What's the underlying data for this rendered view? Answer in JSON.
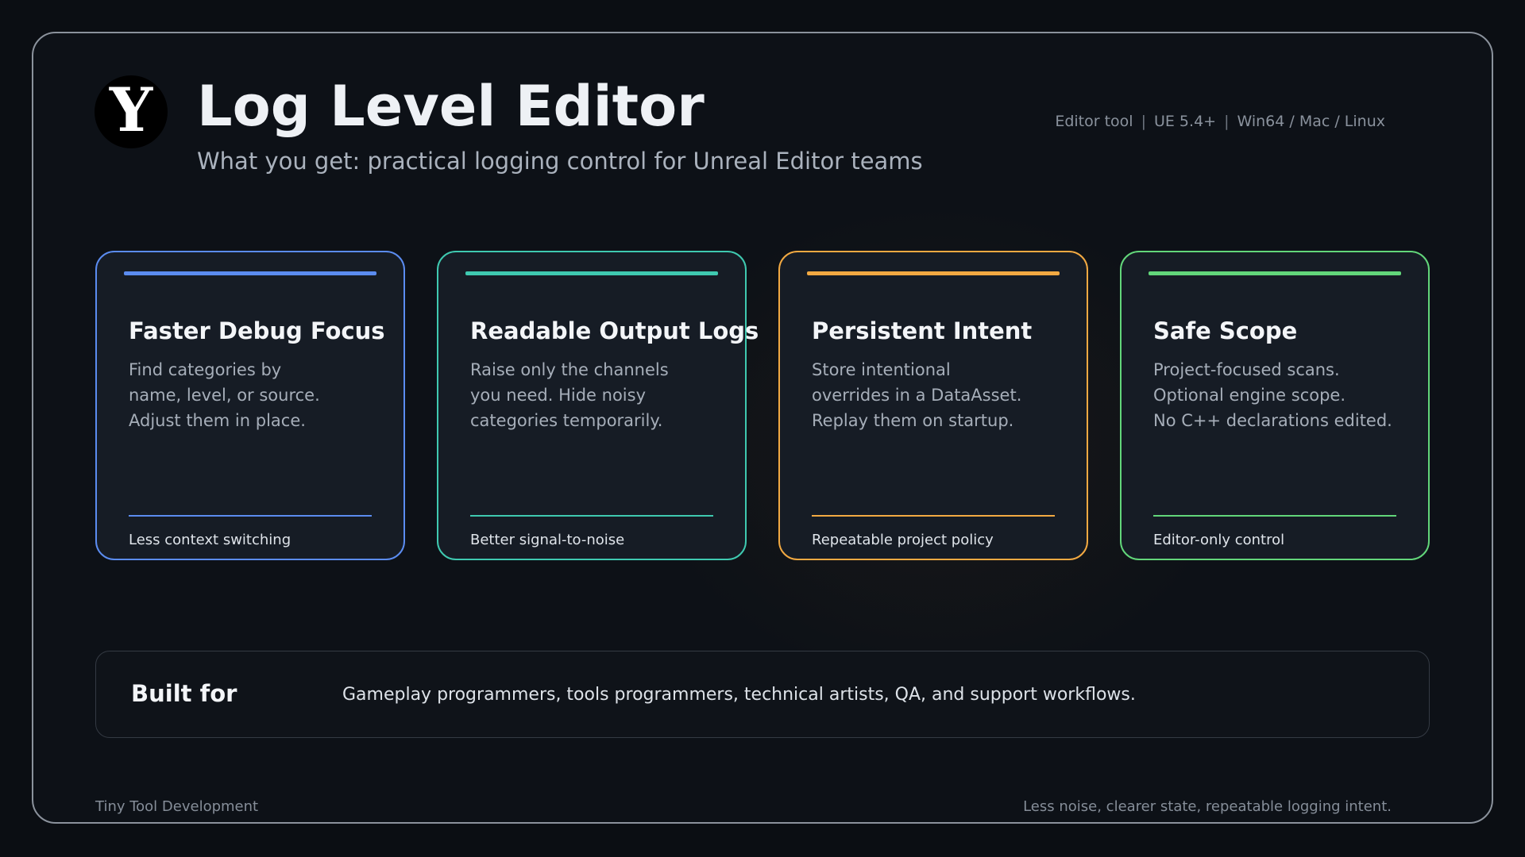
{
  "header": {
    "logo_letter": "Y",
    "title": "Log Level Editor",
    "subtitle": "What you get: practical logging control for Unreal Editor teams",
    "meta": [
      "Editor tool",
      "UE 5.4+",
      "Win64 / Mac / Linux"
    ],
    "meta_separator": "|"
  },
  "cards": [
    {
      "title": "Faster Debug Focus",
      "body": [
        "Find categories by",
        "name, level, or source.",
        "Adjust them in place."
      ],
      "footer": "Less context switching",
      "accent": "#5b8cf0"
    },
    {
      "title": "Readable Output Logs",
      "body": [
        "Raise only the channels",
        "you need. Hide noisy",
        "categories temporarily."
      ],
      "footer": "Better signal-to-noise",
      "accent": "#3fc9b0"
    },
    {
      "title": "Persistent Intent",
      "body": [
        "Store intentional",
        "overrides in a DataAsset.",
        "Replay them on startup."
      ],
      "footer": "Repeatable project policy",
      "accent": "#f2a942"
    },
    {
      "title": "Safe Scope",
      "body": [
        "Project-focused scans.",
        "Optional engine scope.",
        "No C++ declarations edited."
      ],
      "footer": "Editor-only control",
      "accent": "#62d67a"
    }
  ],
  "built_for": {
    "label": "Built for",
    "text": "Gameplay programmers, tools programmers, technical artists, QA, and support workflows."
  },
  "footer": {
    "left": "Tiny Tool Development",
    "right": "Less noise, clearer state, repeatable logging intent."
  }
}
